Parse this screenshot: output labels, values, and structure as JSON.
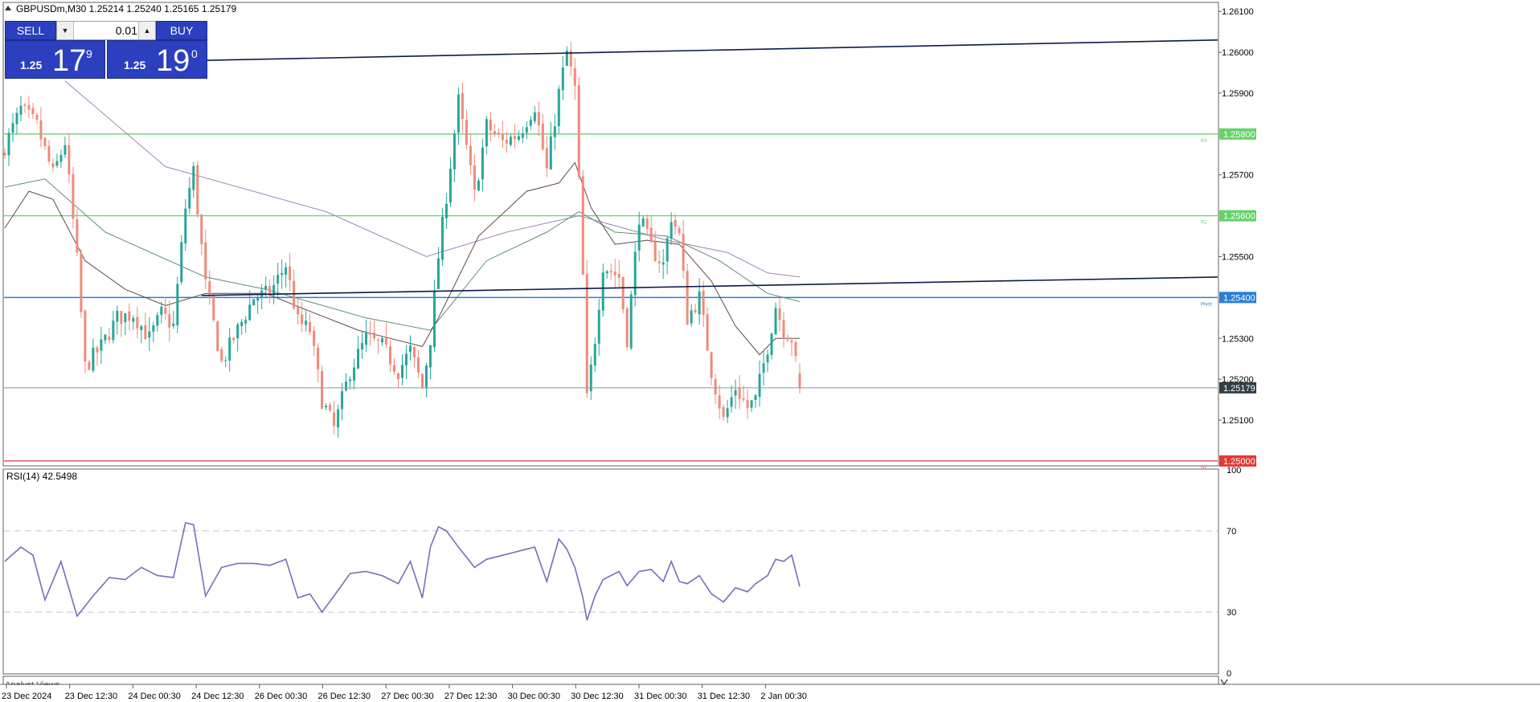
{
  "header": {
    "symbol_info": "GBPUSDm,M30  1.25214 1.25240 1.25165 1.25179",
    "triangle_icon": "triangle-up-icon"
  },
  "trade_panel": {
    "sell_label": "SELL",
    "buy_label": "BUY",
    "lot_value": "0.01",
    "sell_price": {
      "small": "1.25",
      "big": "17",
      "sup": "9"
    },
    "buy_price": {
      "small": "1.25",
      "big": "19",
      "sup": "0"
    }
  },
  "bottom_tab": {
    "label": "Analyst Views"
  },
  "colors": {
    "bull": "#26a69a",
    "bear": "#ef8a7a",
    "resistance": "#66d26b",
    "support": "#e53935",
    "pivot": "#2a7fd4",
    "trend": "#0d1a4a",
    "rsi": "#7e6ab8"
  },
  "chart_data": [
    {
      "type": "candlestick",
      "symbol": "GBPUSDm",
      "timeframe": "M30",
      "ohlc_header": {
        "open": 1.25214,
        "high": 1.2524,
        "low": 1.25165,
        "close": 1.25179
      },
      "ylim": [
        1.2499,
        1.2612
      ],
      "y_ticks": [
        "1.26100",
        "1.26000",
        "1.25900",
        "1.25700",
        "1.25500",
        "1.25300",
        "1.25200",
        "1.25100"
      ],
      "x_ticks": [
        "23 Dec 2024",
        "23 Dec 12:30",
        "24 Dec 00:30",
        "24 Dec 12:30",
        "26 Dec 00:30",
        "26 Dec 12:30",
        "27 Dec 00:30",
        "27 Dec 12:30",
        "30 Dec 00:30",
        "30 Dec 12:30",
        "31 Dec 00:30",
        "31 Dec 12:30",
        "2 Jan 00:30"
      ],
      "levels": [
        {
          "label": "1.25800",
          "tag": "R3",
          "value": 1.258,
          "color": "#66d26b"
        },
        {
          "label": "1.25600",
          "tag": "R2",
          "value": 1.256,
          "color": "#66d26b"
        },
        {
          "label": "1.25400",
          "tag": "Pivot",
          "value": 1.254,
          "color": "#2a7fd4"
        },
        {
          "label": "1.25000",
          "tag": "S1",
          "value": 1.25,
          "color": "#e53935"
        }
      ],
      "current_price": {
        "label": "1.25179",
        "value": 1.25179
      },
      "close_path": [
        [
          0,
          1.2577
        ],
        [
          4,
          1.2586
        ],
        [
          8,
          1.2582
        ],
        [
          12,
          1.257
        ],
        [
          15,
          1.2578
        ],
        [
          18,
          1.2549
        ],
        [
          20,
          1.2523
        ],
        [
          24,
          1.2528
        ],
        [
          28,
          1.2535
        ],
        [
          32,
          1.2536
        ],
        [
          36,
          1.253
        ],
        [
          39,
          1.2536
        ],
        [
          42,
          1.2533
        ],
        [
          45,
          1.2562
        ],
        [
          47,
          1.2571
        ],
        [
          50,
          1.2543
        ],
        [
          54,
          1.2524
        ],
        [
          58,
          1.2532
        ],
        [
          62,
          1.254
        ],
        [
          66,
          1.2541
        ],
        [
          70,
          1.2548
        ],
        [
          73,
          1.2534
        ],
        [
          76,
          1.2532
        ],
        [
          79,
          1.2515
        ],
        [
          82,
          1.2508
        ],
        [
          86,
          1.2522
        ],
        [
          90,
          1.253
        ],
        [
          94,
          1.2528
        ],
        [
          98,
          1.2522
        ],
        [
          101,
          1.2527
        ],
        [
          104,
          1.2518
        ],
        [
          106,
          1.253
        ],
        [
          108,
          1.255
        ],
        [
          110,
          1.2565
        ],
        [
          113,
          1.2588
        ],
        [
          117,
          1.2565
        ],
        [
          120,
          1.2582
        ],
        [
          124,
          1.2578
        ],
        [
          128,
          1.258
        ],
        [
          132,
          1.2587
        ],
        [
          135,
          1.2571
        ],
        [
          138,
          1.259
        ],
        [
          140,
          1.26
        ],
        [
          142,
          1.2591
        ],
        [
          144,
          1.2545
        ],
        [
          145,
          1.2515
        ],
        [
          147,
          1.253
        ],
        [
          149,
          1.2548
        ],
        [
          153,
          1.2545
        ],
        [
          155,
          1.253
        ],
        [
          158,
          1.256
        ],
        [
          161,
          1.2552
        ],
        [
          164,
          1.2548
        ],
        [
          166,
          1.256
        ],
        [
          168,
          1.2555
        ],
        [
          170,
          1.2535
        ],
        [
          173,
          1.254
        ],
        [
          176,
          1.2522
        ],
        [
          179,
          1.251
        ],
        [
          182,
          1.2518
        ],
        [
          185,
          1.2513
        ],
        [
          187,
          1.2515
        ],
        [
          190,
          1.2528
        ],
        [
          192,
          1.2538
        ],
        [
          194,
          1.2532
        ],
        [
          196,
          1.253
        ],
        [
          198,
          1.25179
        ]
      ],
      "moving_averages": [
        {
          "color": "#9c86b8",
          "points": [
            [
              15,
              1.2593
            ],
            [
              40,
              1.2572
            ],
            [
              80,
              1.2561
            ],
            [
              105,
              1.255
            ],
            [
              125,
              1.2556
            ],
            [
              143,
              1.256
            ],
            [
              165,
              1.2554
            ],
            [
              180,
              1.2551
            ],
            [
              190,
              1.2546
            ],
            [
              198,
              1.2545
            ]
          ]
        },
        {
          "color": "#5f8f75",
          "points": [
            [
              0,
              1.2567
            ],
            [
              10,
              1.2569
            ],
            [
              25,
              1.2556
            ],
            [
              50,
              1.2545
            ],
            [
              65,
              1.2542
            ],
            [
              90,
              1.2535
            ],
            [
              106,
              1.2532
            ],
            [
              120,
              1.2549
            ],
            [
              135,
              1.2556
            ],
            [
              143,
              1.2561
            ],
            [
              152,
              1.2556
            ],
            [
              165,
              1.2555
            ],
            [
              178,
              1.2549
            ],
            [
              190,
              1.2541
            ],
            [
              198,
              1.2539
            ]
          ]
        },
        {
          "color": "#604848",
          "points": [
            [
              0,
              1.2557
            ],
            [
              6,
              1.2566
            ],
            [
              12,
              1.2564
            ],
            [
              20,
              1.2549
            ],
            [
              30,
              1.2542
            ],
            [
              40,
              1.2538
            ],
            [
              50,
              1.2541
            ],
            [
              65,
              1.2541
            ],
            [
              75,
              1.2537
            ],
            [
              88,
              1.2532
            ],
            [
              96,
              1.253
            ],
            [
              104,
              1.2528
            ],
            [
              108,
              1.2535
            ],
            [
              118,
              1.2555
            ],
            [
              130,
              1.2566
            ],
            [
              138,
              1.2568
            ],
            [
              142,
              1.2573
            ],
            [
              146,
              1.2562
            ],
            [
              152,
              1.2553
            ],
            [
              160,
              1.2554
            ],
            [
              168,
              1.2553
            ],
            [
              176,
              1.2544
            ],
            [
              182,
              1.2533
            ],
            [
              188,
              1.2526
            ],
            [
              192,
              1.253
            ],
            [
              198,
              1.253
            ]
          ]
        }
      ],
      "trend_lines": [
        {
          "from": [
            49,
            1.2598
          ],
          "to": [
            202,
            1.2603
          ]
        },
        {
          "from": [
            49,
            1.25405
          ],
          "to": [
            202,
            1.2545
          ]
        }
      ]
    },
    {
      "type": "line",
      "title": "RSI(14) 42.5498",
      "ylim": [
        0,
        100
      ],
      "y_ticks": [
        "100",
        "70",
        "30",
        "0"
      ],
      "levels": [
        70,
        30
      ],
      "x": [
        0,
        4,
        7,
        10,
        14,
        18,
        22,
        26,
        30,
        34,
        38,
        42,
        45,
        47,
        50,
        54,
        58,
        62,
        66,
        70,
        73,
        76,
        79,
        82,
        86,
        90,
        94,
        98,
        101,
        104,
        106,
        108,
        110,
        113,
        117,
        120,
        124,
        128,
        132,
        135,
        138,
        140,
        142,
        144,
        145,
        147,
        149,
        153,
        155,
        158,
        161,
        164,
        166,
        168,
        170,
        173,
        176,
        179,
        182,
        185,
        187,
        190,
        192,
        194,
        196,
        198
      ],
      "values": [
        55,
        62,
        58,
        36,
        55,
        28,
        38,
        47,
        46,
        52,
        48,
        47,
        74,
        73,
        38,
        52,
        54,
        54,
        53,
        56,
        37,
        39,
        30,
        38,
        49,
        50,
        48,
        44,
        55,
        37,
        62,
        72,
        70,
        62,
        52,
        56,
        58,
        60,
        62,
        45,
        66,
        61,
        52,
        37,
        26,
        38,
        46,
        50,
        43,
        50,
        51,
        45,
        55,
        45,
        44,
        48,
        39,
        35,
        42,
        40,
        44,
        48,
        56,
        55,
        58,
        42.55
      ]
    }
  ]
}
